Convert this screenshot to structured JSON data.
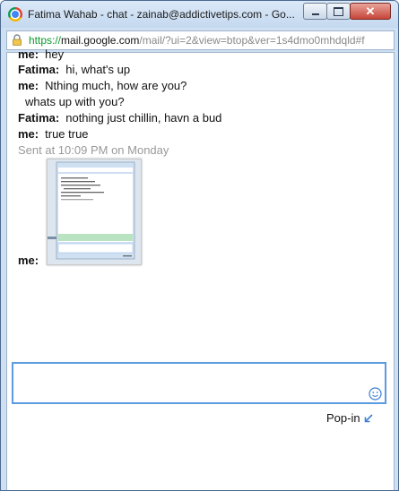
{
  "window": {
    "title": "Fatima Wahab - chat - zainab@addictivetips.com - Go...",
    "controls": {
      "minimize": "minimize-icon",
      "maximize": "maximize-icon",
      "close": "close-icon"
    }
  },
  "address": {
    "scheme": "https://",
    "host": "mail.google.com",
    "path": "/mail/?ui=2&view=btop&ver=1s4dmo0mhdqld#f"
  },
  "chat": {
    "messages": [
      {
        "sender": "me:",
        "text": "hey"
      },
      {
        "sender": "Fatima:",
        "text": "hi, what's up"
      },
      {
        "sender": "me:",
        "text": "Nthing much, how are you?"
      },
      {
        "continuation": "whats up with you?"
      },
      {
        "sender": "Fatima:",
        "text": "nothing just chillin, havn a bud"
      },
      {
        "sender": "me:",
        "text": "true true"
      }
    ],
    "sent_note": "Sent at 10:09 PM on Monday",
    "attachment_sender": "me:"
  },
  "composer": {
    "value": "",
    "emoji_icon": "smiley-icon"
  },
  "popin": {
    "label": "Pop-in",
    "icon": "arrow-down-left-icon"
  }
}
